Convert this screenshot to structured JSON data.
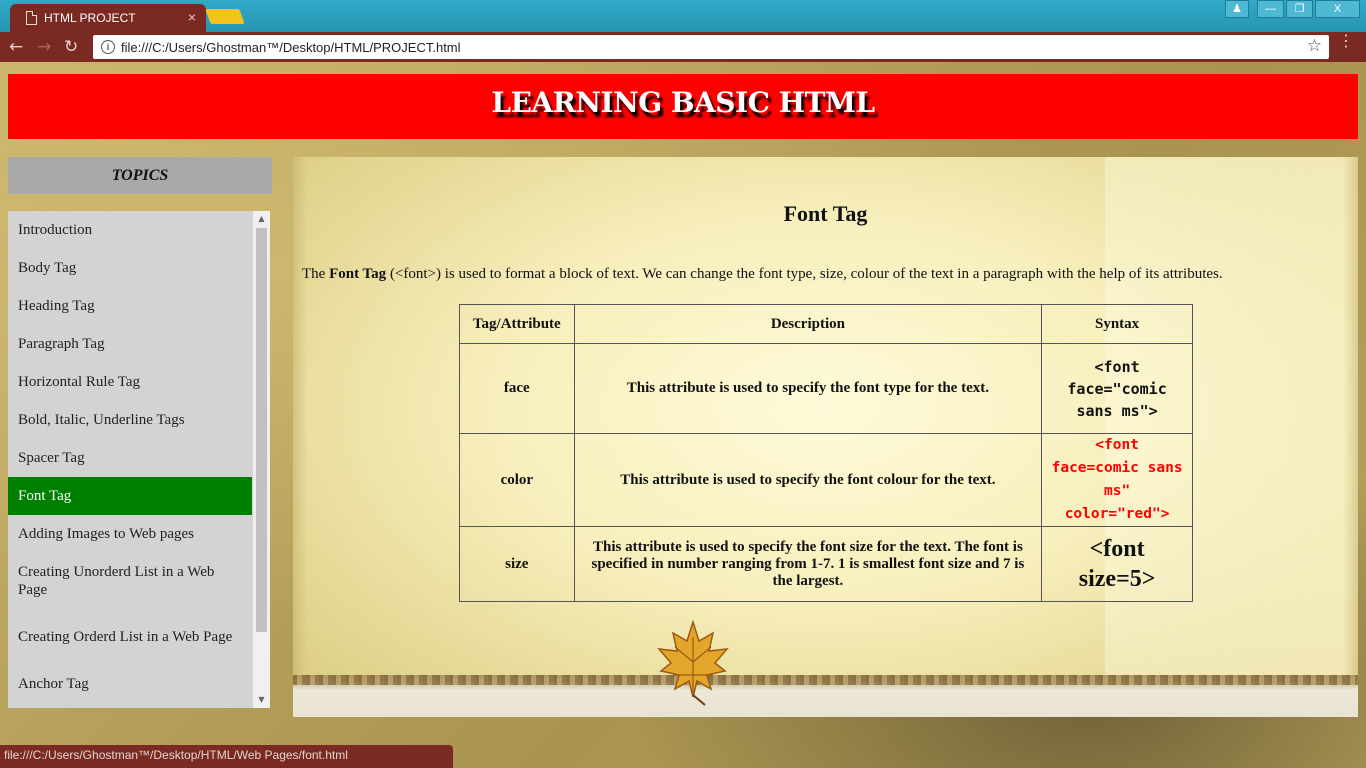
{
  "browser": {
    "tab_title": "HTML PROJECT",
    "tab_close": "×",
    "url": "file:///C:/Users/Ghostman™/Desktop/HTML/PROJECT.html",
    "status_url": "file:///C:/Users/Ghostman™/Desktop/HTML/Web Pages/font.html",
    "window_buttons": {
      "minimize": "—",
      "maximize": "❐",
      "close": "X"
    }
  },
  "page": {
    "banner_title": "LEARNING BASIC HTML",
    "topics_heading": "TOPICS",
    "sidebar": {
      "items": [
        {
          "label": "Introduction"
        },
        {
          "label": "Body Tag"
        },
        {
          "label": "Heading Tag"
        },
        {
          "label": "Paragraph Tag"
        },
        {
          "label": "Horizontal Rule Tag"
        },
        {
          "label": "Bold, Italic, Underline Tags"
        },
        {
          "label": "Spacer Tag"
        },
        {
          "label": "Font Tag",
          "active": true
        },
        {
          "label": "Adding Images to Web pages"
        },
        {
          "label": "Creating Unorderd List in a Web Page"
        },
        {
          "label": "Creating Orderd List in a Web Page"
        },
        {
          "label": "Anchor Tag"
        }
      ]
    },
    "content": {
      "title": "Font Tag",
      "intro": {
        "prefix": "The ",
        "bold": "Font Tag",
        "rest": " (<font>) is used to format a block of text. We can change the font type, size, colour of the text in a paragraph with the help of its attributes."
      },
      "table": {
        "headers": [
          "Tag/Attribute",
          "Description",
          "Syntax"
        ],
        "rows": [
          {
            "attr": "face",
            "desc": "This attribute is used to specify the font type for the text.",
            "syntax": "<font face=\"comic sans ms\">"
          },
          {
            "attr": "color",
            "desc": "This attribute is used to specify the font colour for the text.",
            "syntax": "<font face=comic sans ms\" color=\"red\">"
          },
          {
            "attr": "size",
            "desc": "This attribute is used to specify the font size for the text. The font is specified in number ranging from 1-7. 1 is smallest font size and 7 is the largest.",
            "syntax": "<font size=5>"
          }
        ]
      }
    }
  },
  "colors": {
    "banner": "#ff0000",
    "active_item": "#008000",
    "chrome": "#7a2a23",
    "titlebar": "#2fa9c6"
  }
}
